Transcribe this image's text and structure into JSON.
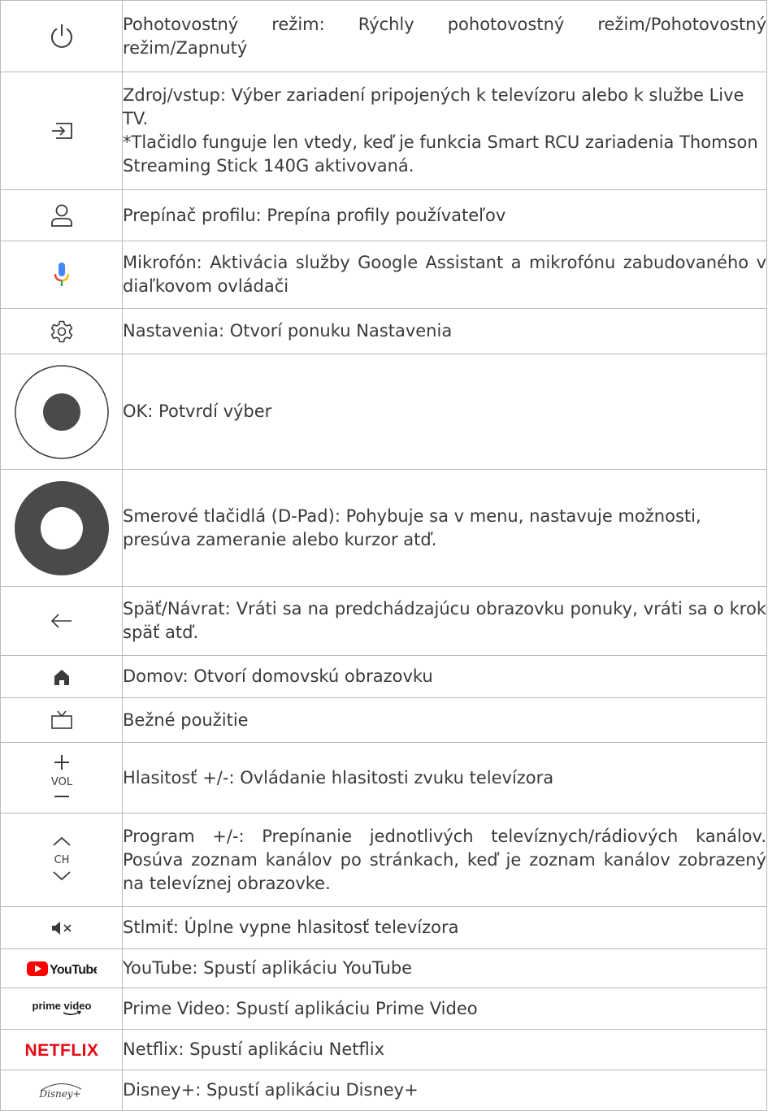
{
  "rows": [
    {
      "icon": "power-icon",
      "text": "Pohotovostný režim: Rýchly pohotovostný režim/Pohotovostný režim/Zapnutý"
    },
    {
      "icon": "input-source-icon",
      "text": "Zdroj/vstup: Výber zariadení pripojených k televízoru alebo k službe Live TV.",
      "note": "*Tlačidlo funguje len vtedy, keď je funkcia Smart RCU zariadenia Thomson Streaming Stick 140G aktivovaná."
    },
    {
      "icon": "profile-icon",
      "text": "Prepínač profilu: Prepína profily používateľov"
    },
    {
      "icon": "microphone-icon",
      "text": "Mikrofón: Aktivácia služby Google Assistant a mikrofónu zabudovaného v diaľkovom ovládači"
    },
    {
      "icon": "gear-icon",
      "text": "Nastavenia: Otvorí ponuku Nastavenia"
    },
    {
      "icon": "ok-button-icon",
      "text": "OK: Potvrdí výber"
    },
    {
      "icon": "dpad-icon",
      "text": "Smerové tlačidlá (D-Pad): Pohybuje sa v menu, nastavuje možnosti, presúva zameranie alebo kurzor atď."
    },
    {
      "icon": "back-arrow-icon",
      "text": "Späť/Návrat: Vráti sa na predchádzajúcu obrazovku ponuky, vráti sa o krok späť atď."
    },
    {
      "icon": "home-icon",
      "text": "Domov: Otvorí domovskú obrazovku"
    },
    {
      "icon": "tv-icon",
      "text": "Bežné použitie"
    },
    {
      "icon": "volume-icon",
      "icon_label": "VOL",
      "text": "Hlasitosť +/-: Ovládanie hlasitosti zvuku televízora"
    },
    {
      "icon": "channel-icon",
      "icon_label": "CH",
      "text": "Program +/-: Prepínanie jednotlivých televíznych/rádiových kanálov. Posúva zoznam kanálov po stránkach, keď je zoznam kanálov zobrazený na televíznej obrazovke."
    },
    {
      "icon": "mute-icon",
      "text": "Stlmiť: Úplne vypne hlasitosť televízora"
    },
    {
      "icon": "youtube-logo-icon",
      "icon_label": "YouTube",
      "text": "YouTube: Spustí aplikáciu YouTube"
    },
    {
      "icon": "prime-video-logo-icon",
      "icon_label": "prime video",
      "text": "Prime Video: Spustí aplikáciu Prime Video"
    },
    {
      "icon": "netflix-logo-icon",
      "icon_label": "NETFLIX",
      "text": "Netflix: Spustí aplikáciu Netflix"
    },
    {
      "icon": "disney-plus-logo-icon",
      "icon_label": "Disney+",
      "text": "Disney+: Spustí aplikáciu Disney+"
    }
  ],
  "colors": {
    "text": "#3a3a3a",
    "border": "#b9b9b9",
    "button_fill": "#4a4a4c",
    "youtube_red": "#ff0000",
    "netflix_red": "#e50914",
    "mic_blue": "#4285f4",
    "mic_red": "#ea4335",
    "mic_yellow": "#fbbc05",
    "mic_green": "#34a853"
  }
}
